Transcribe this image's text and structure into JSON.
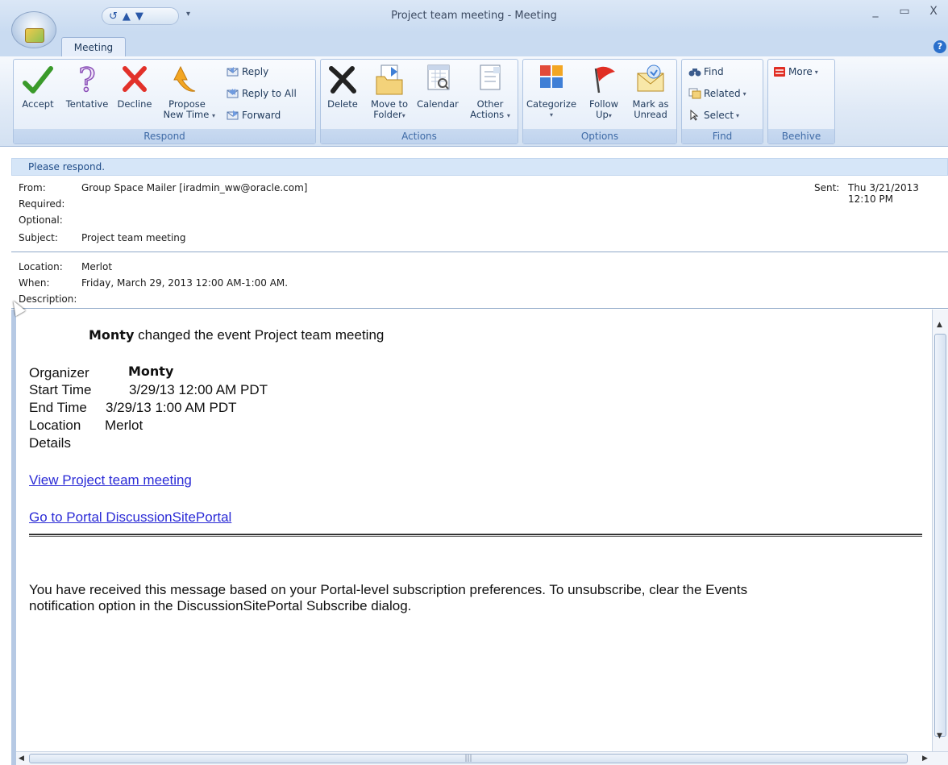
{
  "window": {
    "title": "Project team meeting - Meeting",
    "controls": [
      "_",
      "▭",
      "X"
    ]
  },
  "tabs": [
    {
      "label": "Meeting"
    }
  ],
  "ribbon": {
    "respond": {
      "label": "Respond",
      "accept": "Accept",
      "tentative": "Tentative",
      "decline": "Decline",
      "propose_line1": "Propose",
      "propose_line2": "New Time",
      "reply": "Reply",
      "reply_all": "Reply to All",
      "forward": "Forward"
    },
    "actions": {
      "label": "Actions",
      "delete": "Delete",
      "move_line1": "Move to",
      "move_line2": "Folder",
      "calendar": "Calendar",
      "other_line1": "Other",
      "other_line2": "Actions"
    },
    "options": {
      "label": "Options",
      "categorize": "Categorize",
      "follow_line1": "Follow",
      "follow_line2": "Up",
      "mark_line1": "Mark as",
      "mark_line2": "Unread"
    },
    "find": {
      "label": "Find",
      "find": "Find",
      "related": "Related",
      "select": "Select"
    },
    "beehive": {
      "label": "Beehive",
      "more": "More"
    }
  },
  "infobar": "Please respond.",
  "header": {
    "from_label": "From:",
    "from_value": "Group Space Mailer [iradmin_ww@oracle.com]",
    "required_label": "Required:",
    "optional_label": "Optional:",
    "subject_label": "Subject:",
    "subject_value": "Project team meeting",
    "sent_label": "Sent:",
    "sent_value": "Thu 3/21/2013 12:10 PM",
    "location_label": "Location:",
    "location_value": "Merlot",
    "when_label": "When:",
    "when_value": "Friday, March 29, 2013 12:00 AM-1:00 AM.",
    "description_label": "Description:"
  },
  "body": {
    "headline_name": "Monty",
    "headline_rest": " changed the event Project team meeting",
    "organizer_label": "Organizer",
    "organizer_value": "Monty",
    "start_label": "Start Time",
    "start_value": "3/29/13 12:00 AM PDT",
    "end_label": "End Time",
    "end_value": "3/29/13 1:00 AM PDT",
    "location_label": "Location",
    "location_value": "Merlot",
    "details_label": "Details",
    "link_view": "View Project team meeting",
    "link_portal": "Go to Portal DiscussionSitePortal",
    "footer_line1": "You have received this message based on your Portal-level subscription preferences. To unsubscribe, clear the Events",
    "footer_line2": "notification option in the DiscussionSitePortal Subscribe dialog."
  }
}
